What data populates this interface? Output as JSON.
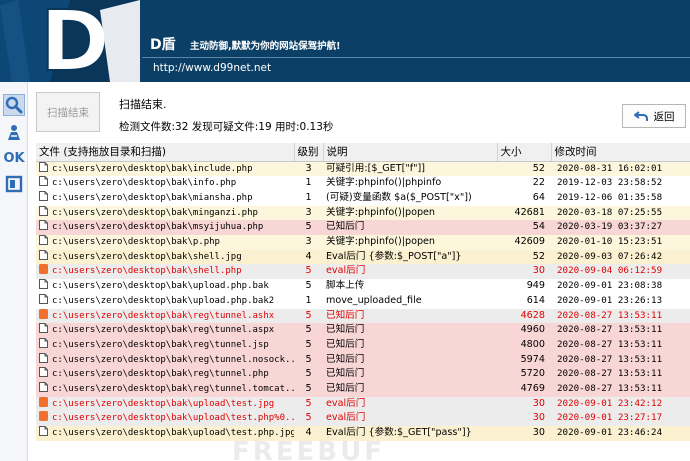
{
  "header": {
    "brand": "D盾",
    "slogan": "主动防御,默默为你的网站保驾护航!",
    "url": "http://www.d99net.net",
    "logo_text": "D"
  },
  "toolbar": {
    "tools": [
      {
        "icon": "search-icon",
        "active": true
      },
      {
        "icon": "person-tool-icon",
        "active": false
      },
      {
        "icon": "ok-icon",
        "label": "OK",
        "active": false
      },
      {
        "icon": "window-icon",
        "active": false
      }
    ]
  },
  "status": {
    "scan_button_label": "扫描结束",
    "title": "扫描结束.",
    "detail": "检测文件数:32 发现可疑文件:19 用时:0.13秒",
    "back_button_label": "返回"
  },
  "table": {
    "columns": [
      "文件 (支持拖放目录和扫描)",
      "级别",
      "说明",
      "大小",
      "修改时间"
    ],
    "rows": [
      {
        "file": "c:\\users\\zero\\desktop\\bak\\include.php",
        "level": "3",
        "desc": "可疑引用:[$_GET[\"f\"]]",
        "size": "52",
        "time": "2020-08-31 16:02:01",
        "bg": "#fbf6dc",
        "red": false,
        "icon": "page"
      },
      {
        "file": "c:\\users\\zero\\desktop\\bak\\info.php",
        "level": "1",
        "desc": "关键字:phpinfo()|phpinfo",
        "size": "22",
        "time": "2019-12-03 23:58:52",
        "bg": "#ffffff",
        "red": false,
        "icon": "page"
      },
      {
        "file": "c:\\users\\zero\\desktop\\bak\\miansha.php",
        "level": "1",
        "desc": "(可疑)变量函数 $a($_POST[\"x\"])",
        "size": "64",
        "time": "2019-12-06 01:35:58",
        "bg": "#ffffff",
        "red": false,
        "icon": "page"
      },
      {
        "file": "c:\\users\\zero\\desktop\\bak\\minganzi.php",
        "level": "3",
        "desc": "关键字:phpinfo()|popen",
        "size": "42681",
        "time": "2020-03-18 07:25:55",
        "bg": "#fbf6dc",
        "red": false,
        "icon": "page"
      },
      {
        "file": "c:\\users\\zero\\desktop\\bak\\msyijuhua.php",
        "level": "5",
        "desc": "已知后门",
        "size": "54",
        "time": "2020-03-19 03:37:27",
        "bg": "#f9d6d6",
        "red": false,
        "icon": "page"
      },
      {
        "file": "c:\\users\\zero\\desktop\\bak\\p.php",
        "level": "3",
        "desc": "关键字:phpinfo()|popen",
        "size": "42609",
        "time": "2020-01-10 15:23:51",
        "bg": "#fbf6dc",
        "red": false,
        "icon": "page"
      },
      {
        "file": "c:\\users\\zero\\desktop\\bak\\shell.jpg",
        "level": "4",
        "desc": "Eval后门 {参数:$_POST[\"a\"]}",
        "size": "52",
        "time": "2020-09-03 07:26:42",
        "bg": "#fbf0d0",
        "red": false,
        "icon": "page"
      },
      {
        "file": "c:\\users\\zero\\desktop\\bak\\shell.php",
        "level": "5",
        "desc": "eval后门",
        "size": "30",
        "time": "2020-09-04 06:12:59",
        "bg": "#ececec",
        "red": true,
        "icon": "orange"
      },
      {
        "file": "c:\\users\\zero\\desktop\\bak\\upload.php.bak",
        "level": "5",
        "desc": "脚本上传",
        "size": "949",
        "time": "2020-09-01 23:08:38",
        "bg": "#ffffff",
        "red": false,
        "icon": "page"
      },
      {
        "file": "c:\\users\\zero\\desktop\\bak\\upload.php.bak2",
        "level": "1",
        "desc": "move_uploaded_file",
        "size": "614",
        "time": "2020-09-01 23:26:13",
        "bg": "#ffffff",
        "red": false,
        "icon": "page"
      },
      {
        "file": "c:\\users\\zero\\desktop\\bak\\reg\\tunnel.ashx",
        "level": "5",
        "desc": "已知后门",
        "size": "4628",
        "time": "2020-08-27 13:53:11",
        "bg": "#ececec",
        "red": true,
        "icon": "orange"
      },
      {
        "file": "c:\\users\\zero\\desktop\\bak\\reg\\tunnel.aspx",
        "level": "5",
        "desc": "已知后门",
        "size": "4960",
        "time": "2020-08-27 13:53:11",
        "bg": "#f9d6d6",
        "red": false,
        "icon": "page"
      },
      {
        "file": "c:\\users\\zero\\desktop\\bak\\reg\\tunnel.jsp",
        "level": "5",
        "desc": "已知后门",
        "size": "4800",
        "time": "2020-08-27 13:53:11",
        "bg": "#f9d6d6",
        "red": false,
        "icon": "page"
      },
      {
        "file": "c:\\users\\zero\\desktop\\bak\\reg\\tunnel.nosock...",
        "level": "5",
        "desc": "已知后门",
        "size": "5974",
        "time": "2020-08-27 13:53:11",
        "bg": "#f9d6d6",
        "red": false,
        "icon": "page"
      },
      {
        "file": "c:\\users\\zero\\desktop\\bak\\reg\\tunnel.php",
        "level": "5",
        "desc": "已知后门",
        "size": "5720",
        "time": "2020-08-27 13:53:11",
        "bg": "#f9d6d6",
        "red": false,
        "icon": "page"
      },
      {
        "file": "c:\\users\\zero\\desktop\\bak\\reg\\tunnel.tomcat...",
        "level": "5",
        "desc": "已知后门",
        "size": "4769",
        "time": "2020-08-27 13:53:11",
        "bg": "#f9d6d6",
        "red": false,
        "icon": "page"
      },
      {
        "file": "c:\\users\\zero\\desktop\\bak\\upload\\test.jpg",
        "level": "5",
        "desc": "eval后门",
        "size": "30",
        "time": "2020-09-01 23:42:12",
        "bg": "#ececec",
        "red": true,
        "icon": "orange"
      },
      {
        "file": "c:\\users\\zero\\desktop\\bak\\upload\\test.php%0...",
        "level": "5",
        "desc": "eval后门",
        "size": "30",
        "time": "2020-09-01 23:27:17",
        "bg": "#ececec",
        "red": true,
        "icon": "orange"
      },
      {
        "file": "c:\\users\\zero\\desktop\\bak\\upload\\test.php.jpg",
        "level": "4",
        "desc": "Eval后门 {参数:$_GET[\"pass\"]}",
        "size": "30",
        "time": "2020-09-01 23:46:24",
        "bg": "#fbf0d0",
        "red": false,
        "icon": "page"
      }
    ]
  },
  "watermark": "FREEBUF",
  "colors": {
    "header_bg": "#0b3f66",
    "danger_text": "#e00000",
    "row_warning": "#fbf6dc",
    "row_danger": "#f9d6d6",
    "row_flagged": "#ececec",
    "icon_orange": "#f07030"
  }
}
